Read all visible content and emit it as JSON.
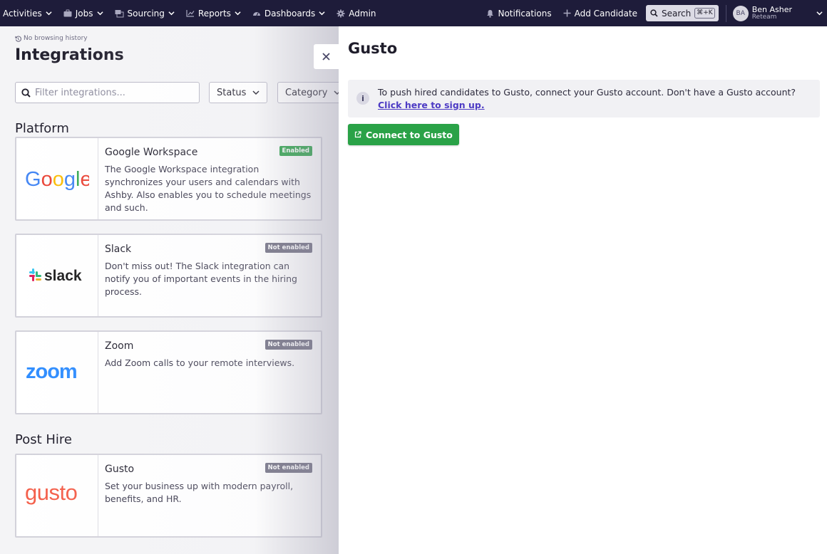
{
  "topnav": {
    "items": [
      {
        "label": "Activities",
        "icon": "none",
        "dropdown": true
      },
      {
        "label": "Jobs",
        "icon": "briefcase-icon",
        "dropdown": true
      },
      {
        "label": "Sourcing",
        "icon": "sourcing-icon",
        "dropdown": true
      },
      {
        "label": "Reports",
        "icon": "chart-icon",
        "dropdown": true
      },
      {
        "label": "Dashboards",
        "icon": "gauge-icon",
        "dropdown": true
      },
      {
        "label": "Admin",
        "icon": "gear-icon",
        "dropdown": false
      }
    ],
    "notifications_label": "Notifications",
    "add_candidate_label": "Add Candidate",
    "search_label": "Search",
    "search_shortcut": "⌘+K",
    "user": {
      "initials": "BA",
      "name": "Ben Asher",
      "org": "Reteam"
    }
  },
  "page": {
    "history_label": "No browsing history",
    "title": "Integrations",
    "filter_placeholder": "Filter integrations...",
    "status_select": "Status",
    "category_select": "Category",
    "sections": [
      {
        "title": "Platform",
        "cards": [
          {
            "name": "Google Workspace",
            "badge": "Enabled",
            "enabled": true,
            "logo": "Google",
            "desc": "The Google Workspace integration synchronizes your users and calendars with Ashby. Also enables you to schedule meetings and such."
          },
          {
            "name": "Slack",
            "badge": "Not enabled",
            "enabled": false,
            "logo": "slack",
            "desc": "Don't miss out! The Slack integration can notify you of important events in the hiring process."
          },
          {
            "name": "Zoom",
            "badge": "Not enabled",
            "enabled": false,
            "logo": "zoom",
            "desc": "Add Zoom calls to your remote interviews."
          }
        ]
      },
      {
        "title": "Post Hire",
        "cards": [
          {
            "name": "Gusto",
            "badge": "Not enabled",
            "enabled": false,
            "logo": "gusto",
            "desc": "Set your business up with modern payroll, benefits, and HR."
          }
        ]
      }
    ]
  },
  "panel": {
    "title": "Gusto",
    "info_text": "To push hired candidates to Gusto, connect your Gusto account. Don't have a Gusto account?",
    "info_link": "Click here to sign up.",
    "connect_label": "Connect to Gusto"
  },
  "colors": {
    "nav_bg": "#1e1c3a",
    "enabled_green": "#2aa247",
    "disabled_badge": "#6f6d80",
    "link_purple": "#4d3bc4"
  }
}
